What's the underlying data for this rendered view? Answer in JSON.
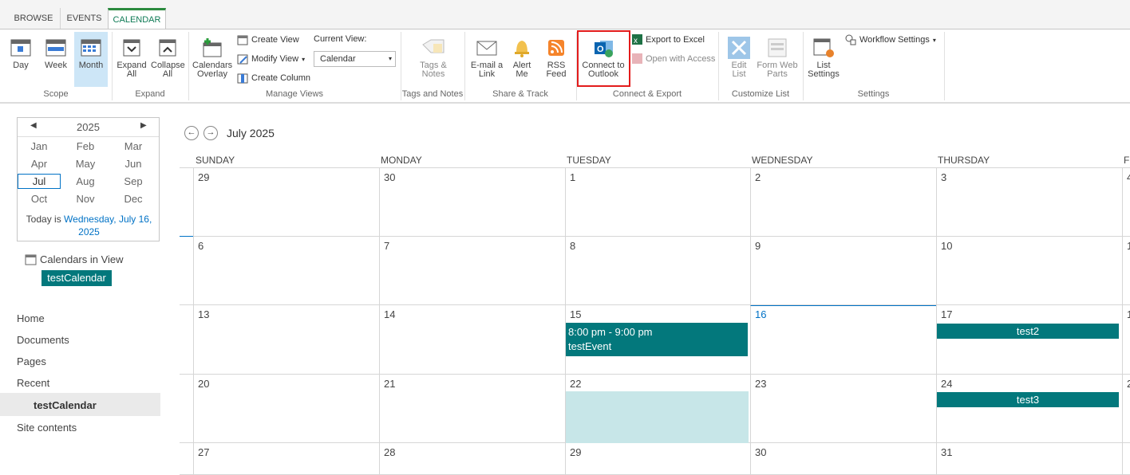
{
  "tabs": [
    "BROWSE",
    "EVENTS",
    "CALENDAR"
  ],
  "ribbon": {
    "scope": {
      "label": "Scope",
      "day": "Day",
      "week": "Week",
      "month": "Month"
    },
    "expand": {
      "label": "Expand",
      "expand_all": "Expand All",
      "collapse_all": "Collapse All"
    },
    "manage_views": {
      "label": "Manage Views",
      "calendars_overlay": "Calendars Overlay",
      "create_view": "Create View",
      "modify_view": "Modify View",
      "create_column": "Create Column",
      "current_view_label": "Current View:",
      "current_view_value": "Calendar"
    },
    "tags": {
      "label": "Tags and Notes",
      "tags_notes": "Tags & Notes"
    },
    "share": {
      "label": "Share & Track",
      "email_link": "E-mail a Link",
      "alert_me": "Alert Me",
      "rss_feed": "RSS Feed"
    },
    "connect": {
      "label": "Connect & Export",
      "connect_outlook": "Connect to Outlook",
      "export_excel": "Export to Excel",
      "open_access": "Open with Access"
    },
    "customize": {
      "label": "Customize List",
      "edit_list": "Edit List",
      "form_web_parts": "Form Web Parts"
    },
    "settings": {
      "label": "Settings",
      "list_settings": "List Settings",
      "workflow_settings": "Workflow Settings"
    }
  },
  "datepicker": {
    "year": "2025",
    "months": [
      "Jan",
      "Feb",
      "Mar",
      "Apr",
      "May",
      "Jun",
      "Jul",
      "Aug",
      "Sep",
      "Oct",
      "Nov",
      "Dec"
    ],
    "selected": "Jul",
    "today_prefix": "Today is ",
    "today_link": "Wednesday, July 16, 2025"
  },
  "calendars_in_view": {
    "title": "Calendars in View",
    "item": "testCalendar"
  },
  "quicklaunch": [
    "Home",
    "Documents",
    "Pages",
    "Recent",
    "testCalendar",
    "Site contents"
  ],
  "calendar": {
    "title": "July 2025",
    "days": [
      "SUNDAY",
      "MONDAY",
      "TUESDAY",
      "WEDNESDAY",
      "THURSDAY",
      "F"
    ],
    "weeks": [
      [
        "29",
        "30",
        "1",
        "2",
        "3",
        "4"
      ],
      [
        "6",
        "7",
        "8",
        "9",
        "10",
        "11"
      ],
      [
        "13",
        "14",
        "15",
        "16",
        "17",
        "1"
      ],
      [
        "20",
        "21",
        "22",
        "23",
        "24",
        "2"
      ],
      [
        "27",
        "28",
        "29",
        "30",
        "31",
        ""
      ]
    ],
    "events": {
      "e1_time": "8:00 pm - 9:00 pm",
      "e1_title": "testEvent",
      "e2_title": "test2",
      "e3_title": "test3"
    }
  },
  "colors": {
    "accent": "#03787c",
    "highlight": "#e31c1c",
    "selected_cell": "#c7e6e8"
  }
}
